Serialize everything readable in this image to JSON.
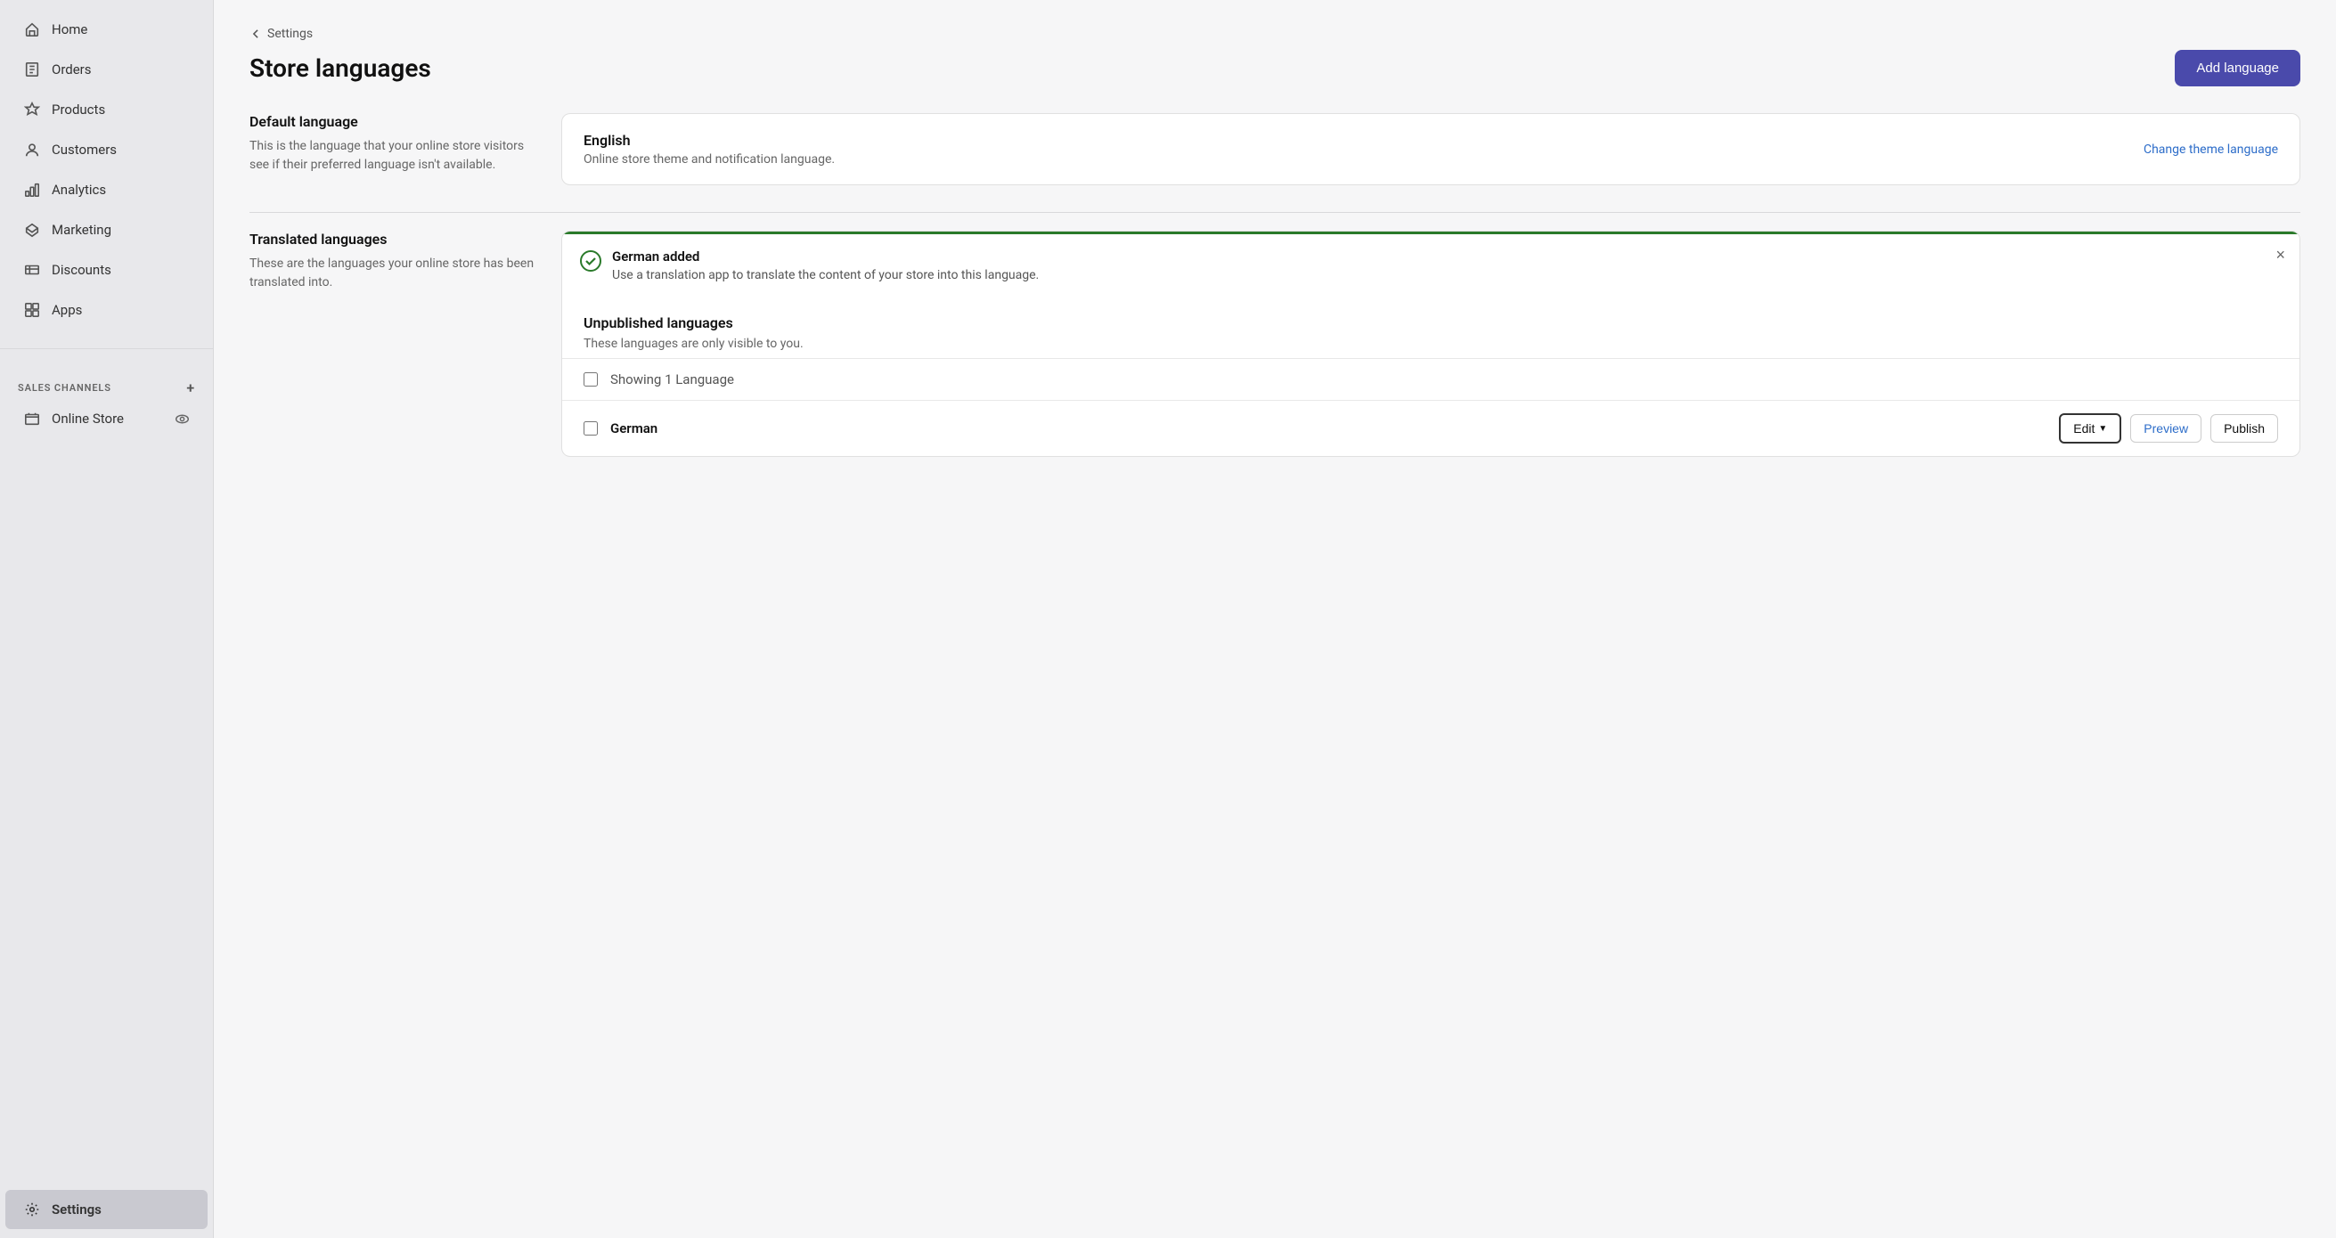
{
  "sidebar": {
    "items": [
      {
        "id": "home",
        "label": "Home",
        "icon": "home"
      },
      {
        "id": "orders",
        "label": "Orders",
        "icon": "orders"
      },
      {
        "id": "products",
        "label": "Products",
        "icon": "products"
      },
      {
        "id": "customers",
        "label": "Customers",
        "icon": "customers"
      },
      {
        "id": "analytics",
        "label": "Analytics",
        "icon": "analytics"
      },
      {
        "id": "marketing",
        "label": "Marketing",
        "icon": "marketing"
      },
      {
        "id": "discounts",
        "label": "Discounts",
        "icon": "discounts"
      },
      {
        "id": "apps",
        "label": "Apps",
        "icon": "apps"
      }
    ],
    "sales_channels_label": "SALES CHANNELS",
    "online_store_label": "Online Store",
    "settings_label": "Settings"
  },
  "breadcrumb": {
    "back_label": "Settings"
  },
  "header": {
    "title": "Store languages",
    "add_language_label": "Add language"
  },
  "default_language_section": {
    "heading": "Default language",
    "description": "This is the language that your online store visitors see if their preferred language isn't available.",
    "card": {
      "language_name": "English",
      "description": "Online store theme and notification language.",
      "change_link": "Change theme language"
    }
  },
  "translated_languages_section": {
    "heading": "Translated languages",
    "description": "These are the languages your online store has been translated into.",
    "notification": {
      "title": "German added",
      "description": "Use a translation app to translate the content of your store into this language."
    },
    "unpublished": {
      "heading": "Unpublished languages",
      "description": "These languages are only visible to you.",
      "count_row_label": "Showing 1 Language",
      "languages": [
        {
          "name": "German",
          "actions": {
            "edit": "Edit",
            "preview": "Preview",
            "publish": "Publish"
          }
        }
      ]
    }
  }
}
